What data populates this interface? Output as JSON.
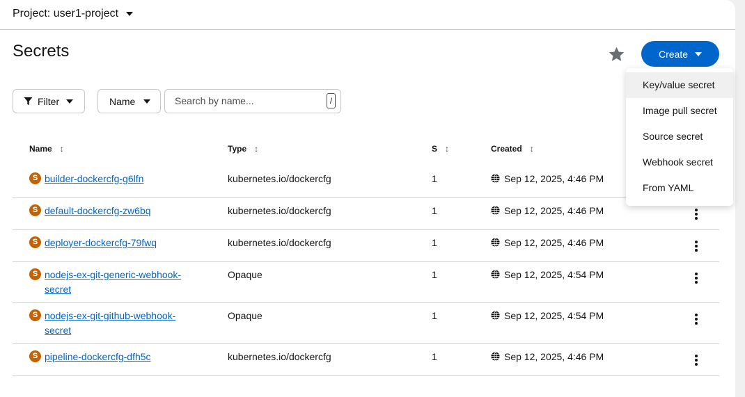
{
  "header": {
    "project_label": "Project: user1-project"
  },
  "page": {
    "title": "Secrets"
  },
  "toolbar": {
    "create_label": "Create",
    "filter_label": "Filter",
    "name_select": "Name",
    "search_placeholder": "Search by name...",
    "search_shortcut": "/"
  },
  "table": {
    "headers": {
      "name": "Name",
      "type": "Type",
      "size": "S",
      "created": "Created"
    },
    "rows": [
      {
        "badge": "S",
        "name": "builder-dockercfg-g6lfn",
        "type": "kubernetes.io/dockercfg",
        "size": "1",
        "created": "Sep 12, 2025, 4:46 PM"
      },
      {
        "badge": "S",
        "name": "default-dockercfg-zw6bq",
        "type": "kubernetes.io/dockercfg",
        "size": "1",
        "created": "Sep 12, 2025, 4:46 PM"
      },
      {
        "badge": "S",
        "name": "deployer-dockercfg-79fwq",
        "type": "kubernetes.io/dockercfg",
        "size": "1",
        "created": "Sep 12, 2025, 4:46 PM"
      },
      {
        "badge": "S",
        "name": "nodejs-ex-git-generic-webhook-secret",
        "type": "Opaque",
        "size": "1",
        "created": "Sep 12, 2025, 4:54 PM"
      },
      {
        "badge": "S",
        "name": "nodejs-ex-git-github-webhook-secret",
        "type": "Opaque",
        "size": "1",
        "created": "Sep 12, 2025, 4:54 PM"
      },
      {
        "badge": "S",
        "name": "pipeline-dockercfg-dfh5c",
        "type": "kubernetes.io/dockercfg",
        "size": "1",
        "created": "Sep 12, 2025, 4:46 PM"
      }
    ]
  },
  "create_menu": {
    "items": [
      "Key/value secret",
      "Image pull secret",
      "Source secret",
      "Webhook secret",
      "From YAML"
    ]
  },
  "colors": {
    "primary": "#0066cc",
    "badge": "#c46100",
    "star": "#6a6e73"
  },
  "icons": {
    "favorite": "star-icon",
    "filter": "filter-icon",
    "created": "globe-icon",
    "row_actions": "kebab-icon"
  }
}
